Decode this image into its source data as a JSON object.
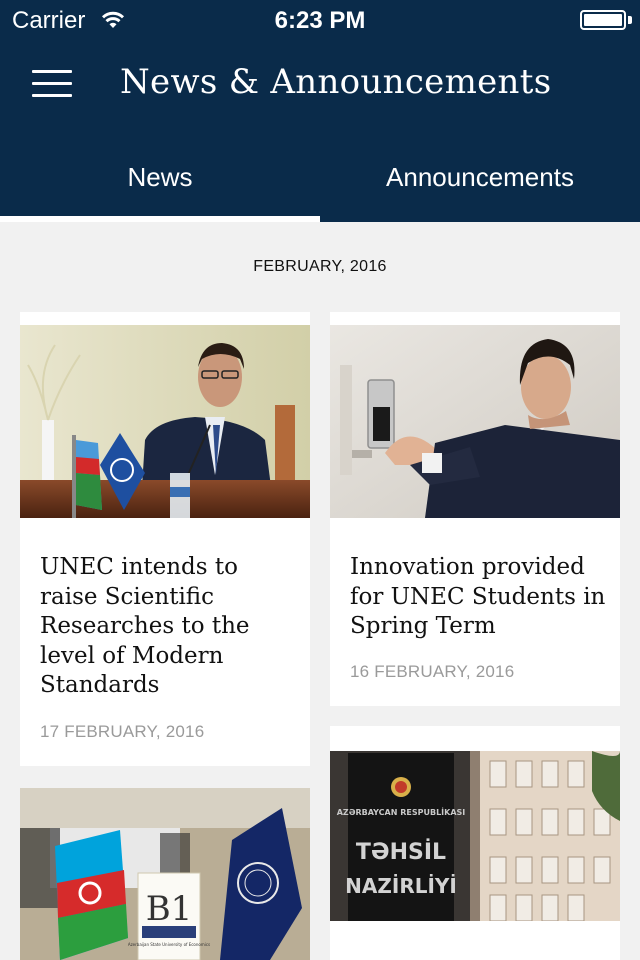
{
  "status_bar": {
    "carrier": "Carrier",
    "time": "6:23 PM"
  },
  "nav": {
    "title": "News & Announcements"
  },
  "tabs": [
    {
      "label": "News",
      "selected": true
    },
    {
      "label": "Announcements",
      "selected": false
    }
  ],
  "section": {
    "month": "FEBRUARY, 2016"
  },
  "articles": [
    {
      "title": "UNEC intends to raise Scientific Researches to the level of Modern Standards",
      "date": "17 FEBRUARY, 2016"
    },
    {
      "title": "Innovation provided for UNEC Students in Spring Term",
      "date": "16 FEBRUARY, 2016"
    },
    {
      "title": "",
      "date": ""
    },
    {
      "title": "",
      "date": ""
    }
  ],
  "image_texts": {
    "b1_sign": "B1",
    "b1_caption": "Azerbaijan State University of Economics",
    "ministry_line1": "AZƏRBAYCAN RESPUBLİKASI",
    "ministry_line2": "TƏHSİL",
    "ministry_line3": "NAZİRLİYİ"
  },
  "colors": {
    "header_bg": "#0a2b4a",
    "page_bg": "#f1f1f1",
    "card_bg": "#ffffff",
    "date_grey": "#9a9a9a"
  }
}
